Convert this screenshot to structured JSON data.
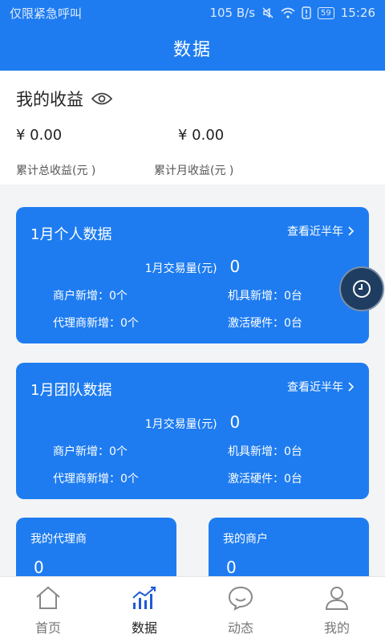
{
  "status": {
    "left": "仅限紧急呼叫",
    "speed": "105 B/s",
    "battery": "59",
    "time": "15:26"
  },
  "header": {
    "title": "数据"
  },
  "earnings": {
    "title": "我的收益",
    "total_value": "¥ 0.00",
    "month_value": "¥ 0.00",
    "total_label": "累计总收益(元 )",
    "month_label": "累计月收益(元 )"
  },
  "personal": {
    "title": "1月个人数据",
    "link": "查看近半年",
    "volume_label": "1月交易量(元)",
    "volume_value": "0",
    "merchants_new": "商户新增：0个",
    "machines_new": "机具新增：0台",
    "agents_new": "代理商新增：0个",
    "hardware_active": "激活硬件：0台"
  },
  "team": {
    "title": "1月团队数据",
    "link": "查看近半年",
    "volume_label": "1月交易量(元)",
    "volume_value": "0",
    "merchants_new": "商户新增：0个",
    "machines_new": "机具新增：0台",
    "agents_new": "代理商新增：0个",
    "hardware_active": "激活硬件：0台"
  },
  "my_agents": {
    "title": "我的代理商",
    "value": "0"
  },
  "my_merchants": {
    "title": "我的商户",
    "value": "0"
  },
  "tabs": [
    {
      "label": "首页",
      "icon": "home-icon"
    },
    {
      "label": "数据",
      "icon": "chart-icon"
    },
    {
      "label": "动态",
      "icon": "chat-icon"
    },
    {
      "label": "我的",
      "icon": "user-icon"
    }
  ],
  "colors": {
    "primary": "#1e7cf0",
    "active_tab": "#1e5bd6"
  }
}
